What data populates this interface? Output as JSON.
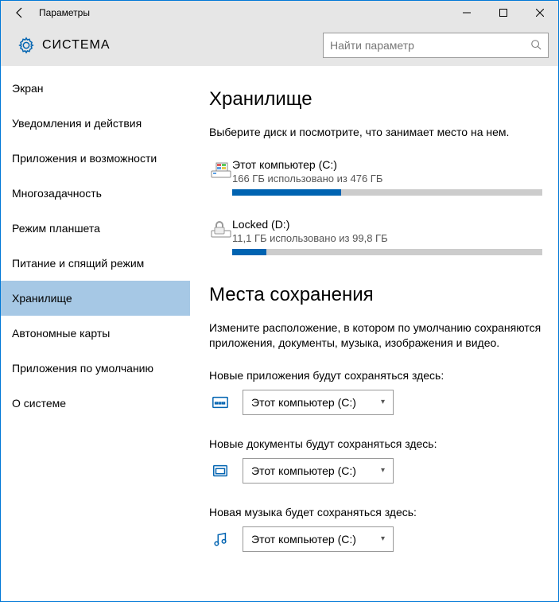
{
  "window": {
    "title": "Параметры"
  },
  "header": {
    "title": "СИСТЕМА",
    "search_placeholder": "Найти параметр"
  },
  "sidebar": {
    "items": [
      {
        "label": "Экран"
      },
      {
        "label": "Уведомления и действия"
      },
      {
        "label": "Приложения и возможности"
      },
      {
        "label": "Многозадачность"
      },
      {
        "label": "Режим планшета"
      },
      {
        "label": "Питание и спящий режим"
      },
      {
        "label": "Хранилище"
      },
      {
        "label": "Автономные карты"
      },
      {
        "label": "Приложения по умолчанию"
      },
      {
        "label": "О системе"
      }
    ],
    "active_index": 6
  },
  "storage": {
    "heading": "Хранилище",
    "subtext": "Выберите диск и посмотрите, что занимает место на нем.",
    "disks": [
      {
        "name": "Этот компьютер (C:)",
        "usage": "166 ГБ использовано из 476 ГБ",
        "percent": 35
      },
      {
        "name": "Locked (D:)",
        "usage": "11,1 ГБ использовано из 99,8 ГБ",
        "percent": 11
      }
    ]
  },
  "save_locations": {
    "heading": "Места сохранения",
    "subtext": "Измените расположение, в котором по умолчанию сохраняются приложения, документы, музыка, изображения и видео.",
    "rows": [
      {
        "label": "Новые приложения будут сохраняться здесь:",
        "value": "Этот компьютер (C:)"
      },
      {
        "label": "Новые документы будут сохраняться здесь:",
        "value": "Этот компьютер (C:)"
      },
      {
        "label": "Новая музыка будет сохраняться здесь:",
        "value": "Этот компьютер (C:)"
      }
    ]
  }
}
